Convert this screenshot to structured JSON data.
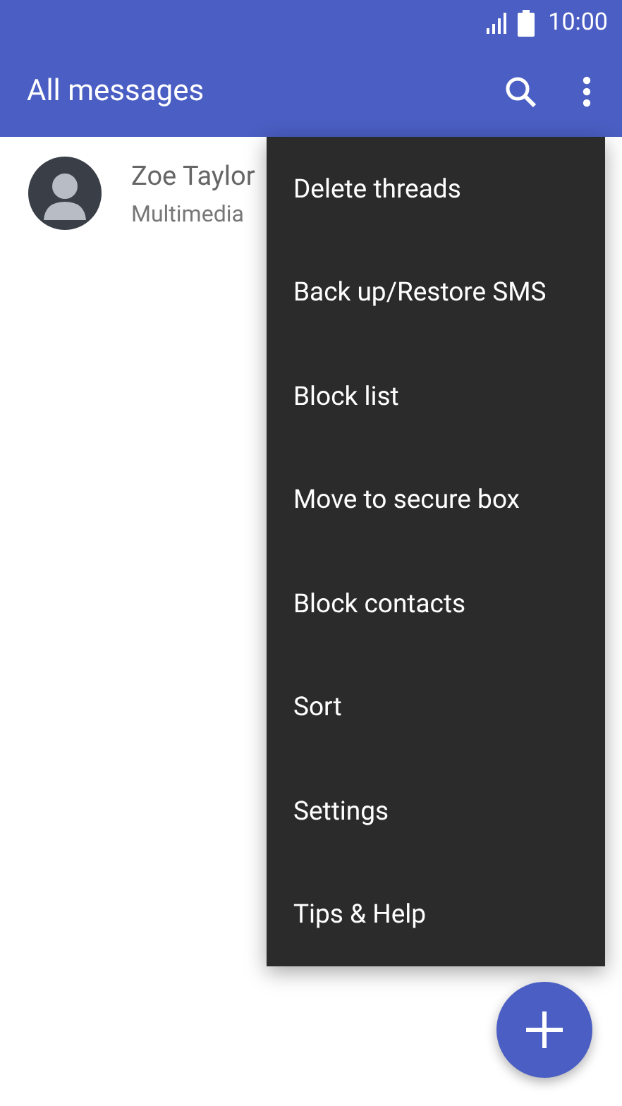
{
  "status_bar": {
    "time": "10:00"
  },
  "app_bar": {
    "title": "All messages"
  },
  "conversations": [
    {
      "name": "Zoe Taylor",
      "preview": "Multimedia"
    }
  ],
  "menu": {
    "items": [
      {
        "label": "Delete threads"
      },
      {
        "label": "Back up/Restore SMS"
      },
      {
        "label": "Block list"
      },
      {
        "label": "Move to secure box"
      },
      {
        "label": "Block contacts"
      },
      {
        "label": "Sort"
      },
      {
        "label": "Settings"
      },
      {
        "label": "Tips & Help"
      }
    ]
  }
}
